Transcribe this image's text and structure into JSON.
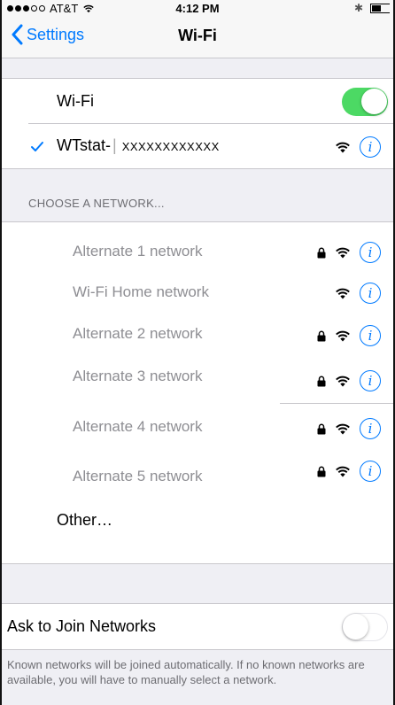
{
  "status_bar": {
    "carrier": "AT&T",
    "time": "4:12 PM",
    "signal_bars_filled": 3,
    "signal_bars_total": 5
  },
  "nav": {
    "back_label": "Settings",
    "title": "Wi-Fi"
  },
  "wifi": {
    "label": "Wi-Fi",
    "enabled": true,
    "connected": {
      "name": "WTstat-",
      "masked": "XXXXXXXXXXXX"
    }
  },
  "choose_network": {
    "header": "CHOOSE A NETWORK...",
    "networks": [
      {
        "name": "Alternate 1 network",
        "locked": true
      },
      {
        "name": "Wi-Fi Home network",
        "locked": false
      },
      {
        "name": "Alternate  2 network",
        "locked": true
      },
      {
        "name": "Alternate 3 network",
        "locked": true
      },
      {
        "name": "Alternate 4 network",
        "locked": true
      },
      {
        "name": "Alternate 5 network",
        "locked": true
      }
    ],
    "other_label": "Other…"
  },
  "ask_to_join": {
    "label": "Ask to Join Networks",
    "enabled": false,
    "footer": "Known networks will be joined automatically. If no known networks are available, you will have to manually select a network."
  },
  "colors": {
    "accent": "#007aff",
    "toggle_on": "#4cd964",
    "background": "#efeff4",
    "secondary_text": "#8e8e93"
  },
  "icons": {
    "back": "chevron-left-icon",
    "check": "checkmark-icon",
    "lock": "lock-icon",
    "wifi": "wifi-icon",
    "info": "info-icon",
    "bluetooth": "bluetooth-icon",
    "battery": "battery-icon"
  }
}
